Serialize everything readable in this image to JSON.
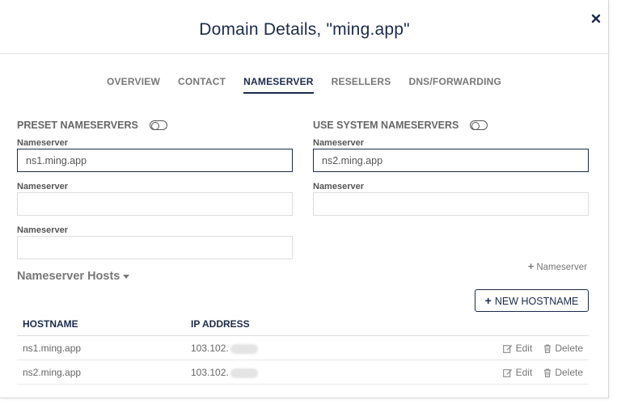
{
  "modal": {
    "title": "Domain Details, \"ming.app\"",
    "close_icon": "close-icon"
  },
  "tabs": [
    {
      "label": "OVERVIEW",
      "active": false
    },
    {
      "label": "CONTACT",
      "active": false
    },
    {
      "label": "NAMESERVER",
      "active": true
    },
    {
      "label": "RESELLERS",
      "active": false
    },
    {
      "label": "DNS/FORWARDING",
      "active": false
    }
  ],
  "preset": {
    "label": "PRESET NAMESERVERS",
    "toggle_on": false
  },
  "system": {
    "label": "USE SYSTEM NAMESERVERS",
    "toggle_on": false
  },
  "nameservers": [
    {
      "label": "Nameserver",
      "value": "ns1.ming.app"
    },
    {
      "label": "Nameserver",
      "value": "ns2.ming.app"
    },
    {
      "label": "Nameserver",
      "value": ""
    },
    {
      "label": "Nameserver",
      "value": ""
    },
    {
      "label": "Nameserver",
      "value": ""
    }
  ],
  "add_nameserver": {
    "icon": "plus-icon",
    "label": "Nameserver"
  },
  "hosts": {
    "title": "Nameserver Hosts",
    "new_button": "NEW HOSTNAME",
    "columns": [
      "HOSTNAME",
      "IP ADDRESS"
    ],
    "rows": [
      {
        "hostname": "ns1.ming.app",
        "ip": "103.102."
      },
      {
        "hostname": "ns2.ming.app",
        "ip": "103.102."
      }
    ],
    "edit_label": "Edit",
    "delete_label": "Delete"
  },
  "colors": {
    "accent": "#1c2b4a",
    "muted": "#777777",
    "border": "#dddddd"
  }
}
